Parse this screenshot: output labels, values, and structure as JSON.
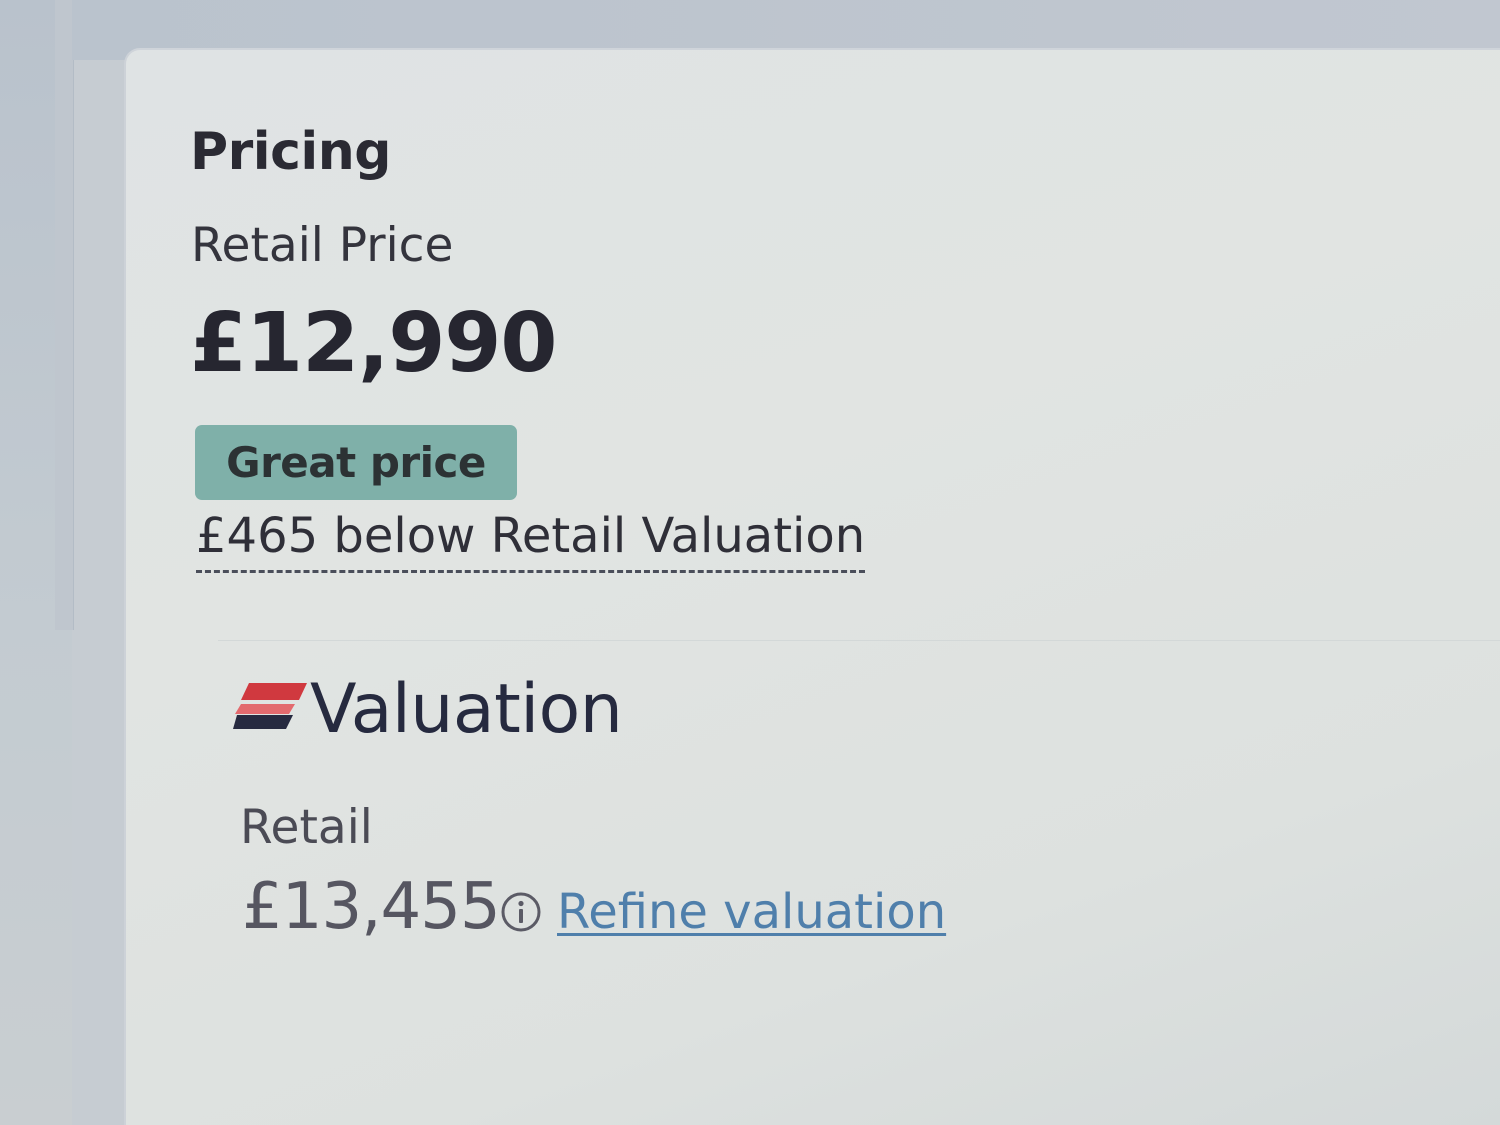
{
  "pricing": {
    "title": "Pricing",
    "retail_price_label": "Retail Price",
    "price": "£12,990",
    "badge": "Great price",
    "badge_color": "#7fb0a9",
    "below_valuation_text": "£465 below Retail Valuation"
  },
  "valuation": {
    "logo_icon": "autotrader-stripes-icon",
    "heading": "Valuation",
    "retail_label": "Retail",
    "retail_value": "£13,455",
    "info_icon": "info-circle-icon",
    "refine_link": "Refine valuation",
    "link_color": "#4f7fab"
  }
}
